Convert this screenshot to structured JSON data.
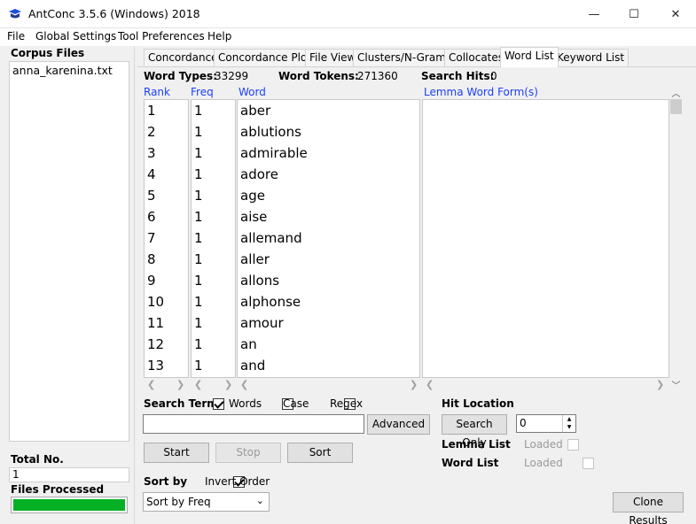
{
  "window": {
    "title": "AntConc 3.5.6 (Windows) 2018",
    "minimize_glyph": "—",
    "maximize_glyph": "☐",
    "close_glyph": "✕"
  },
  "menu": [
    "File",
    "Global Settings",
    "Tool Preferences",
    "Help"
  ],
  "left_panel": {
    "corpus_files_label": "Corpus Files",
    "files": [
      "anna_karenina.txt"
    ],
    "total_no_label": "Total No.",
    "total_no_value": "1",
    "files_processed_label": "Files Processed",
    "progress_percent": 100,
    "progress_color": "#06b025"
  },
  "tabs": [
    "Concordance",
    "Concordance Plot",
    "File View",
    "Clusters/N-Grams",
    "Collocates",
    "Word List",
    "Keyword List"
  ],
  "active_tab": "Word List",
  "stats": {
    "word_types_label": "Word Types:",
    "word_types_value": "33299",
    "word_tokens_label": "Word Tokens:",
    "word_tokens_value": "271360",
    "search_hits_label": "Search Hits:",
    "search_hits_value": "0"
  },
  "columns": {
    "rank": "Rank",
    "freq": "Freq",
    "word": "Word",
    "lemma": "Lemma Word Form(s)",
    "header_color": "#1a3fff"
  },
  "rows": [
    {
      "rank": "1",
      "freq": "1",
      "word": "aber"
    },
    {
      "rank": "2",
      "freq": "1",
      "word": "ablutions"
    },
    {
      "rank": "3",
      "freq": "1",
      "word": "admirable"
    },
    {
      "rank": "4",
      "freq": "1",
      "word": "adore"
    },
    {
      "rank": "5",
      "freq": "1",
      "word": "age"
    },
    {
      "rank": "6",
      "freq": "1",
      "word": "aise"
    },
    {
      "rank": "7",
      "freq": "1",
      "word": "allemand"
    },
    {
      "rank": "8",
      "freq": "1",
      "word": "aller"
    },
    {
      "rank": "9",
      "freq": "1",
      "word": "allons"
    },
    {
      "rank": "10",
      "freq": "1",
      "word": "alphonse"
    },
    {
      "rank": "11",
      "freq": "1",
      "word": "amour"
    },
    {
      "rank": "12",
      "freq": "1",
      "word": "an"
    },
    {
      "rank": "13",
      "freq": "1",
      "word": "and"
    }
  ],
  "search": {
    "search_term_label": "Search Term",
    "words_label": "Words",
    "words_checked": true,
    "case_label": "Case",
    "case_checked": false,
    "regex_label": "Regex",
    "regex_checked": false,
    "input_value": "",
    "advanced_label": "Advanced",
    "start_label": "Start",
    "stop_label": "Stop",
    "sort_label": "Sort"
  },
  "sort": {
    "sort_by_label": "Sort by",
    "invert_order_label": "Invert Order",
    "invert_order_checked": true,
    "selected_option": "Sort by Freq"
  },
  "hit_location": {
    "label": "Hit Location",
    "search_only_label": "Search Only",
    "spin_value": "0",
    "lemma_list_label": "Lemma List",
    "lemma_loaded_label": "Loaded",
    "word_list_label": "Word List",
    "word_loaded_label": "Loaded"
  },
  "clone_results_label": "Clone Results"
}
